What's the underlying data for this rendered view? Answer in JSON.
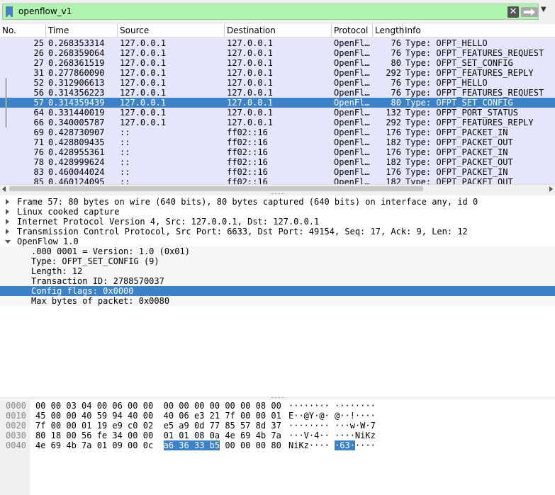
{
  "filter": {
    "value": "openflow_v1"
  },
  "icons": {
    "bookmark": "bookmark-icon",
    "clear": "clear-icon",
    "apply": "arrow-right-icon",
    "dropdown": "chevron-down-icon"
  },
  "colors": {
    "filter_bg": "#aff5b0",
    "row_bg": "#e6e6fb",
    "selection": "#3c82c8"
  },
  "packet_list": {
    "columns": [
      "No.",
      "Time",
      "Source",
      "Destination",
      "Protocol",
      "Length",
      "Info"
    ],
    "rows": [
      {
        "no": "25",
        "time": "0.268353314",
        "src": "127.0.0.1",
        "dst": "127.0.0.1",
        "proto": "OpenFl…",
        "len": "76",
        "info": "Type: OFPT_HELLO"
      },
      {
        "no": "26",
        "time": "0.268359064",
        "src": "127.0.0.1",
        "dst": "127.0.0.1",
        "proto": "OpenFl…",
        "len": "76",
        "info": "Type: OFPT_FEATURES_REQUEST"
      },
      {
        "no": "27",
        "time": "0.268361519",
        "src": "127.0.0.1",
        "dst": "127.0.0.1",
        "proto": "OpenFl…",
        "len": "80",
        "info": "Type: OFPT_SET_CONFIG"
      },
      {
        "no": "31",
        "time": "0.277860090",
        "src": "127.0.0.1",
        "dst": "127.0.0.1",
        "proto": "OpenFl…",
        "len": "292",
        "info": "Type: OFPT_FEATURES_REPLY"
      },
      {
        "no": "52",
        "time": "0.312906613",
        "src": "127.0.0.1",
        "dst": "127.0.0.1",
        "proto": "OpenFl…",
        "len": "76",
        "info": "Type: OFPT_HELLO"
      },
      {
        "no": "56",
        "time": "0.314356223",
        "src": "127.0.0.1",
        "dst": "127.0.0.1",
        "proto": "OpenFl…",
        "len": "76",
        "info": "Type: OFPT_FEATURES_REQUEST"
      },
      {
        "no": "57",
        "time": "0.314359439",
        "src": "127.0.0.1",
        "dst": "127.0.0.1",
        "proto": "OpenFl…",
        "len": "80",
        "info": "Type: OFPT_SET_CONFIG",
        "selected": true
      },
      {
        "no": "64",
        "time": "0.331440019",
        "src": "127.0.0.1",
        "dst": "127.0.0.1",
        "proto": "OpenFl…",
        "len": "132",
        "info": "Type: OFPT_PORT_STATUS"
      },
      {
        "no": "66",
        "time": "0.340005787",
        "src": "127.0.0.1",
        "dst": "127.0.0.1",
        "proto": "OpenFl…",
        "len": "292",
        "info": "Type: OFPT_FEATURES_REPLY"
      },
      {
        "no": "69",
        "time": "0.428730907",
        "src": "::",
        "dst": "ff02::16",
        "proto": "OpenFl…",
        "len": "176",
        "info": "Type: OFPT_PACKET_IN"
      },
      {
        "no": "71",
        "time": "0.428809435",
        "src": "::",
        "dst": "ff02::16",
        "proto": "OpenFl…",
        "len": "182",
        "info": "Type: OFPT_PACKET_OUT"
      },
      {
        "no": "76",
        "time": "0.428955361",
        "src": "::",
        "dst": "ff02::16",
        "proto": "OpenFl…",
        "len": "176",
        "info": "Type: OFPT_PACKET_IN"
      },
      {
        "no": "78",
        "time": "0.428999624",
        "src": "::",
        "dst": "ff02::16",
        "proto": "OpenFl…",
        "len": "182",
        "info": "Type: OFPT_PACKET_OUT"
      },
      {
        "no": "83",
        "time": "0.460044024",
        "src": "::",
        "dst": "ff02::16",
        "proto": "OpenFl…",
        "len": "176",
        "info": "Type: OFPT_PACKET_IN"
      },
      {
        "no": "85",
        "time": "0.460124095",
        "src": "::",
        "dst": "ff02::16",
        "proto": "OpenFl…",
        "len": "182",
        "info": "Type: OFPT_PACKET_OUT"
      }
    ]
  },
  "details": [
    {
      "text": "Frame 57: 80 bytes on wire (640 bits), 80 bytes captured (640 bits) on interface any, id 0",
      "expander": "right"
    },
    {
      "text": "Linux cooked capture",
      "expander": "right"
    },
    {
      "text": "Internet Protocol Version 4, Src: 127.0.0.1, Dst: 127.0.0.1",
      "expander": "right"
    },
    {
      "text": "Transmission Control Protocol, Src Port: 6633, Dst Port: 49154, Seq: 17, Ack: 9, Len: 12",
      "expander": "right"
    },
    {
      "text": "OpenFlow 1.0",
      "expander": "down"
    },
    {
      "text": ".000 0001 = Version: 1.0 (0x01)",
      "child": true
    },
    {
      "text": "Type: OFPT_SET_CONFIG (9)",
      "child": true
    },
    {
      "text": "Length: 12",
      "child": true
    },
    {
      "text": "Transaction ID: 2788570037",
      "child": true
    },
    {
      "text": "Config flags: 0x0000",
      "child": true,
      "selected": true
    },
    {
      "text": "Max bytes of packet: 0x0080",
      "child": true
    }
  ],
  "bytes": [
    {
      "offset": "0000",
      "hex_a": "00 00 03 04 00 06 00 00",
      "hex_b": "00 00 00 00 00 00 08 00",
      "ascii_a": "········",
      "ascii_b": "········"
    },
    {
      "offset": "0010",
      "hex_a": "45 00 00 40 59 94 40 00",
      "hex_b": "40 06 e3 21 7f 00 00 01",
      "ascii_a": "E··@Y·@·",
      "ascii_b": "@··!····"
    },
    {
      "offset": "0020",
      "hex_a": "7f 00 00 01 19 e9 c0 02",
      "hex_b": "e5 a9 0d 77 85 57 8d 37",
      "ascii_a": "········",
      "ascii_b": "···w·W·7"
    },
    {
      "offset": "0030",
      "hex_a": "80 18 00 56 fe 34 00 00",
      "hex_b": "01 01 08 0a 4e 69 4b 7a",
      "ascii_a": "···V·4··",
      "ascii_b": "····NiKz"
    },
    {
      "offset": "0040",
      "hex_a": "4e 69 4b 7a 01 09 00 0c",
      "hex_b_hl": "a6 36 33 b5",
      "hex_b_rest": " 00 00 00 80",
      "ascii_a": "NiKz····",
      "ascii_b_hl": "·63·",
      "ascii_b_rest": "····"
    }
  ]
}
